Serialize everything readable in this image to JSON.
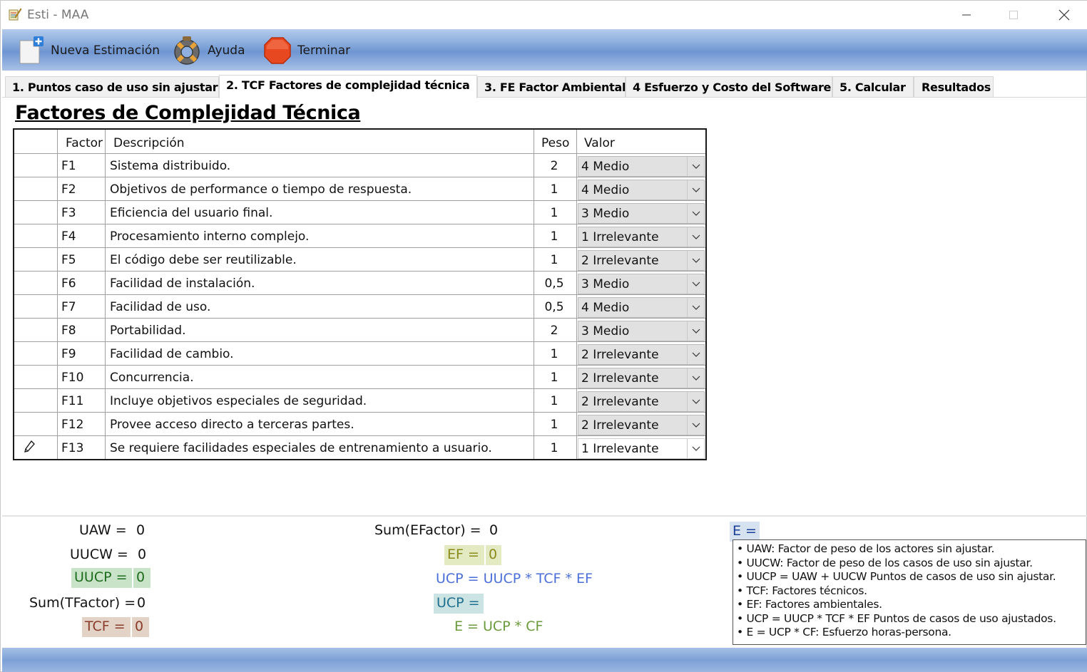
{
  "window": {
    "title": "Esti - MAA"
  },
  "toolbar": {
    "new_label": "Nueva Estimación",
    "help_label": "Ayuda",
    "exit_label": "Terminar"
  },
  "tabs": [
    {
      "label": "1. Puntos caso de uso sin ajustar"
    },
    {
      "label": "2. TCF Factores de complejidad técnica"
    },
    {
      "label": "3. FE Factor Ambiental"
    },
    {
      "label": "4 Esfuerzo y Costo del Software"
    },
    {
      "label": "5. Calcular"
    },
    {
      "label": "Resultados"
    }
  ],
  "section_title": "Factores de Complejidad Técnica",
  "grid": {
    "headers": {
      "factor": "Factor",
      "desc": "Descripción",
      "peso": "Peso",
      "valor": "Valor"
    },
    "rows": [
      {
        "factor": "F1",
        "desc": "Sistema distribuido.",
        "peso": "2",
        "valor": "4 Medio"
      },
      {
        "factor": "F2",
        "desc": "Objetivos de performance o tiempo de respuesta.",
        "peso": "1",
        "valor": "4 Medio"
      },
      {
        "factor": "F3",
        "desc": "Eficiencia del usuario final.",
        "peso": "1",
        "valor": "3 Medio"
      },
      {
        "factor": "F4",
        "desc": "Procesamiento interno complejo.",
        "peso": "1",
        "valor": "1 Irrelevante"
      },
      {
        "factor": "F5",
        "desc": "El código debe ser reutilizable.",
        "peso": "1",
        "valor": "2 Irrelevante"
      },
      {
        "factor": "F6",
        "desc": "Facilidad de instalación.",
        "peso": "0,5",
        "valor": "3 Medio"
      },
      {
        "factor": "F7",
        "desc": "Facilidad de uso.",
        "peso": "0,5",
        "valor": "4 Medio"
      },
      {
        "factor": "F8",
        "desc": "Portabilidad.",
        "peso": "2",
        "valor": "3 Medio"
      },
      {
        "factor": "F9",
        "desc": "Facilidad de cambio.",
        "peso": "1",
        "valor": "2 Irrelevante"
      },
      {
        "factor": "F10",
        "desc": "Concurrencia.",
        "peso": "1",
        "valor": "2 Irrelevante"
      },
      {
        "factor": "F11",
        "desc": "Incluye objetivos especiales de seguridad.",
        "peso": "1",
        "valor": "2 Irrelevante"
      },
      {
        "factor": "F12",
        "desc": "Provee acceso directo a terceras partes.",
        "peso": "1",
        "valor": "2 Irrelevante"
      },
      {
        "factor": "F13",
        "desc": "Se requiere facilidades especiales de entrenamiento a usuario.",
        "peso": "1",
        "valor": "1 Irrelevante"
      }
    ]
  },
  "summary": {
    "uaw_label": "UAW =",
    "uaw_value": "0",
    "uucw_label": "UUCW =",
    "uucw_value": "0",
    "uucp_label": "UUCP =",
    "uucp_value": "0",
    "sumt_label": "Sum(TFactor) =",
    "sumt_value": "0",
    "tcf_label": "TCF =",
    "tcf_value": "0",
    "sume_label": "Sum(EFactor) =",
    "sume_value": "0",
    "ef_label": "EF =",
    "ef_value": "0",
    "ucp_formula": "UCP = UUCP * TCF * EF",
    "ucp_label": "UCP =",
    "e_formula": "E = UCP * CF",
    "e_label": "E ="
  },
  "legend": [
    "• UAW: Factor de peso de los actores sin ajustar.",
    "• UUCW: Factor de peso de los casos de uso sin ajustar.",
    "• UUCP = UAW + UUCW Puntos de casos de uso sin ajustar.",
    "• TCF: Factores técnicos.",
    "• EF: Factores ambientales.",
    "• UCP = UUCP * TCF * EF Puntos de casos de uso ajustados.",
    "• E = UCP * CF: Esfuerzo horas-persona."
  ],
  "colors": {
    "toolbar": "#8fb0de",
    "tab_active": "#ffffff",
    "green": "#1d6b1d",
    "blue": "#1a3d9a"
  }
}
